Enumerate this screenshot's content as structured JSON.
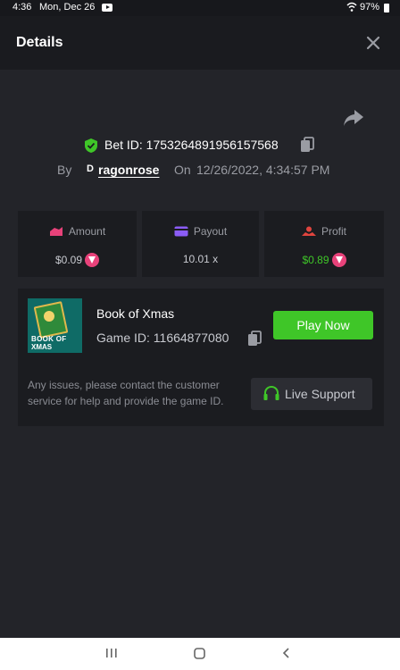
{
  "status_bar": {
    "time": "4:36",
    "date": "Mon, Dec 26",
    "battery": "97%"
  },
  "header": {
    "title": "Details"
  },
  "bet": {
    "id_label": "Bet ID: 1753264891956157568",
    "by_label": "By",
    "avatar_letter": "D",
    "username": "ragonrose",
    "on_label": "On",
    "datetime": "12/26/2022, 4:34:57 PM"
  },
  "stats": {
    "amount": {
      "label": "Amount",
      "value": "$0.09"
    },
    "payout": {
      "label": "Payout",
      "value": "10.01 x"
    },
    "profit": {
      "label": "Profit",
      "value": "$0.89"
    }
  },
  "game": {
    "thumb_title_line1": "BOOK OF",
    "thumb_title_line2": "XMAS",
    "name": "Book of Xmas",
    "game_id": "Game ID: 11664877080",
    "play_label": "Play Now",
    "issue_text": "Any issues, please contact the customer service for help and provide the game ID.",
    "support_label": "Live Support"
  },
  "colors": {
    "background": "#232429",
    "card": "#1b1c20",
    "accent_green": "#3fc628",
    "profit_green": "#3fc628",
    "coin_pink": "#e8427a"
  },
  "icons": [
    "youtube-icon",
    "wifi-icon",
    "battery-icon",
    "close-icon",
    "share-icon",
    "shield-check-icon",
    "copy-icon",
    "amount-icon",
    "payout-icon",
    "profit-icon",
    "coin-icon",
    "headset-icon",
    "recents-icon",
    "home-icon",
    "back-icon"
  ]
}
